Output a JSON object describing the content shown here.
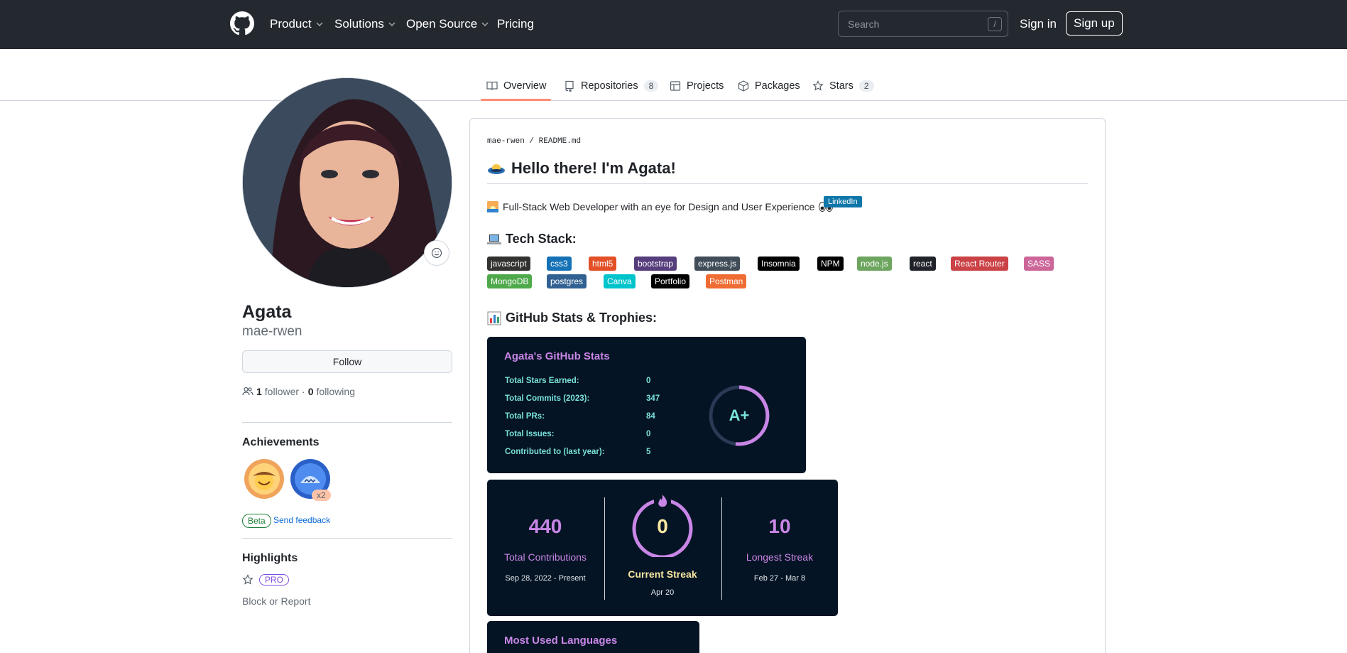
{
  "header": {
    "nav": [
      "Product",
      "Solutions",
      "Open Source",
      "Pricing"
    ],
    "search_placeholder": "Search",
    "search_key": "/",
    "signin": "Sign in",
    "signup": "Sign up"
  },
  "tabs": [
    {
      "label": "Overview",
      "count": ""
    },
    {
      "label": "Repositories",
      "count": "8"
    },
    {
      "label": "Projects",
      "count": ""
    },
    {
      "label": "Packages",
      "count": ""
    },
    {
      "label": "Stars",
      "count": "2"
    }
  ],
  "profile": {
    "name": "Agata",
    "login": "mae-rwen",
    "follow": "Follow",
    "followers_count": "1",
    "followers_label": "follower",
    "sep": "·",
    "following_count": "0",
    "following_label": "following"
  },
  "achievements": {
    "title": "Achievements",
    "multiplier": "x2",
    "beta": "Beta",
    "feedback": "Send feedback"
  },
  "highlights": {
    "title": "Highlights",
    "pro": "PRO",
    "block": "Block or Report"
  },
  "readme": {
    "crumb_owner": "mae-rwen",
    "crumb_sep": "/",
    "crumb_file": "README.md",
    "heading": "Hello there! I'm Agata!",
    "description": "Full-Stack Web Developer with an eye for Design and User Experience",
    "linkedin": "LinkedIn",
    "tech_title": "Tech Stack:",
    "tech": [
      "javascript",
      "css3",
      "html5",
      "bootstrap",
      "express.js",
      "Insomnia",
      "NPM",
      "node.js",
      "react",
      "React Router",
      "SASS",
      "MongoDB",
      "postgres",
      "Canva",
      "Portfolio",
      "Postman"
    ],
    "stats_title": "GitHub Stats & Trophies:"
  },
  "stats_card": {
    "title": "Agata's GitHub Stats",
    "rows": [
      {
        "label": "Total Stars Earned:",
        "value": "0"
      },
      {
        "label": "Total Commits (2023):",
        "value": "347"
      },
      {
        "label": "Total PRs:",
        "value": "84"
      },
      {
        "label": "Total Issues:",
        "value": "0"
      },
      {
        "label": "Contributed to (last year):",
        "value": "5"
      }
    ],
    "grade": "A+"
  },
  "streak_card": {
    "total_value": "440",
    "total_label": "Total Contributions",
    "total_range": "Sep 28, 2022 - Present",
    "current_value": "0",
    "current_label": "Current Streak",
    "current_date": "Apr 20",
    "longest_value": "10",
    "longest_label": "Longest Streak",
    "longest_range": "Feb 27 - Mar 8"
  },
  "languages_card": {
    "title": "Most Used Languages"
  },
  "colors": {
    "header_bg": "#24292f",
    "tab_accent": "#fd8c73",
    "card_bg": "#041424",
    "card_title": "#c986e6",
    "card_text": "#79e2db"
  }
}
